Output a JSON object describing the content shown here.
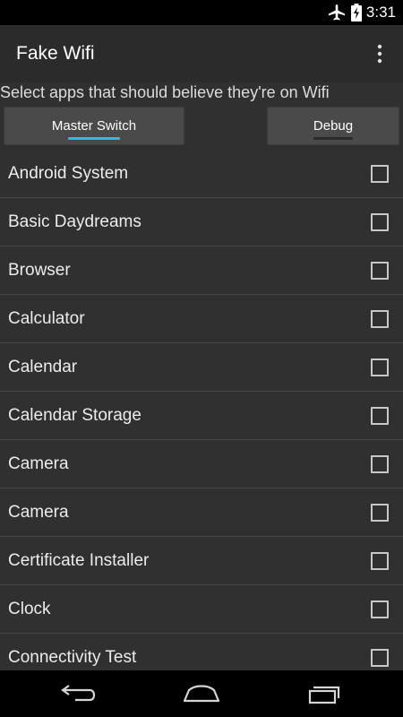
{
  "status_bar": {
    "time": "3:31",
    "icons": [
      "airplane-mode-icon",
      "battery-charging-icon"
    ]
  },
  "action_bar": {
    "title": "Fake Wifi",
    "overflow_icon": "overflow-menu-icon"
  },
  "main": {
    "subtitle": "Select apps that should believe they're on Wifi",
    "buttons": {
      "master_switch": "Master Switch",
      "debug": "Debug"
    },
    "apps": [
      {
        "name": "Android System",
        "checked": false
      },
      {
        "name": "Basic Daydreams",
        "checked": false
      },
      {
        "name": "Browser",
        "checked": false
      },
      {
        "name": "Calculator",
        "checked": false
      },
      {
        "name": "Calendar",
        "checked": false
      },
      {
        "name": "Calendar Storage",
        "checked": false
      },
      {
        "name": "Camera",
        "checked": false
      },
      {
        "name": "Camera",
        "checked": false
      },
      {
        "name": "Certificate Installer",
        "checked": false
      },
      {
        "name": "Clock",
        "checked": false
      },
      {
        "name": "Connectivity Test",
        "checked": false
      }
    ]
  },
  "nav_bar": {
    "icons": [
      "back-icon",
      "home-icon",
      "recent-apps-icon"
    ]
  },
  "colors": {
    "accent": "#33b5e5",
    "background": "#303030",
    "action_bar": "#2b2b2b",
    "button": "#4a4a4a"
  }
}
